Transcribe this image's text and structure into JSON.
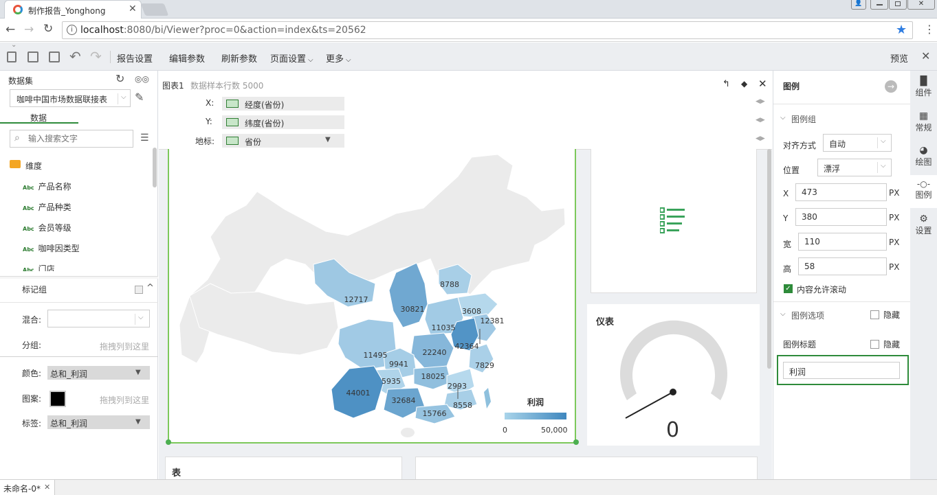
{
  "browser": {
    "tab_title": "制作报告_Yonghong",
    "url_host": "localhost",
    "url_rest": ":8080/bi/Viewer?proc=0&action=index&ts=20562"
  },
  "toolbar": {
    "report_settings": "报告设置",
    "edit_params": "编辑参数",
    "refresh_params": "刷新参数",
    "page_settings": "页面设置",
    "more": "更多",
    "preview": "预览"
  },
  "left": {
    "dataset_label": "数据集",
    "dataset_value": "咖啡中国市场数据联接表",
    "data_tab": "数据",
    "search_placeholder": "输入搜索文字",
    "dimension": "维度",
    "fields": [
      "产品名称",
      "产品种类",
      "会员等级",
      "咖啡因类型",
      "门店"
    ],
    "abc": "Abc",
    "marks_group": "标记组",
    "mix_label": "混合:",
    "group_label": "分组:",
    "drag_hint": "拖拽列到这里",
    "color_label": "颜色:",
    "color_value": "总和_利润",
    "pattern_label": "图案:",
    "label_label": "标签:",
    "label_value": "总和_利润"
  },
  "chart_panel": {
    "title": "图表1",
    "sample_rows": "数据样本行数 5000",
    "x_label": "X:",
    "x_value": "经度(省份)",
    "y_label": "Y:",
    "y_value": "纬度(省份)",
    "geo_label": "地标:",
    "geo_value": "省份",
    "legend_title": "利润",
    "legend_min": "0",
    "legend_max": "50,000"
  },
  "chart_data": {
    "type": "choropleth-map",
    "legend_title": "利润",
    "legend_range": [
      0,
      50000
    ],
    "region_values": [
      8788,
      12717,
      30821,
      3608,
      12381,
      11035,
      42364,
      11495,
      22240,
      9941,
      7829,
      18025,
      5935,
      2993,
      44001,
      32684,
      8558,
      15766
    ]
  },
  "gauge": {
    "title": "仪表",
    "value": "0"
  },
  "table_card": {
    "title": "表"
  },
  "right": {
    "title": "图例",
    "legend_group": "图例组",
    "align_label": "对齐方式",
    "align_value": "自动",
    "position_label": "位置",
    "position_value": "漂浮",
    "x_label": "X",
    "x_value": "473",
    "y_label": "Y",
    "y_value": "380",
    "w_label": "宽",
    "w_value": "110",
    "h_label": "高",
    "h_value": "58",
    "unit": "PX",
    "scroll_label": "内容允许滚动",
    "legend_options": "图例选项",
    "hide": "隐藏",
    "legend_title_label": "图例标题",
    "legend_title_value": "利润"
  },
  "sidetabs": [
    "组件",
    "常规",
    "绘图",
    "图例",
    "设置"
  ],
  "status": {
    "doc_name": "未命名-0*"
  },
  "colors": {
    "accent_green": "#2e8b3a",
    "map_light": "#9ecae1",
    "map_dark": "#3f87be"
  }
}
